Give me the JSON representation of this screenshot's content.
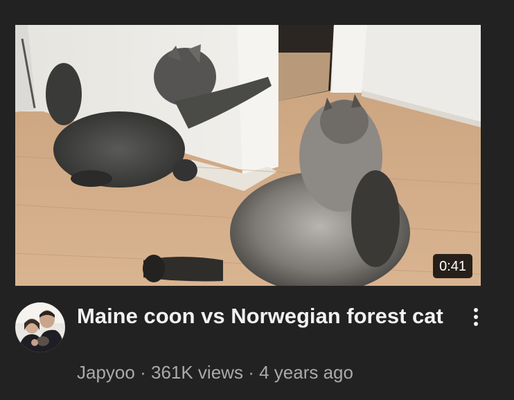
{
  "video": {
    "duration": "0:41",
    "title": "Maine coon vs Norwegian forest cat",
    "channel": "Japyoo",
    "separator": "·",
    "views": "361K views",
    "age": "4 years ago"
  },
  "icons": {
    "more": "more-vert-icon",
    "avatar": "channel-avatar"
  },
  "colors": {
    "background": "#222222",
    "title": "#f1f1f1",
    "meta": "#aaaaaa"
  }
}
